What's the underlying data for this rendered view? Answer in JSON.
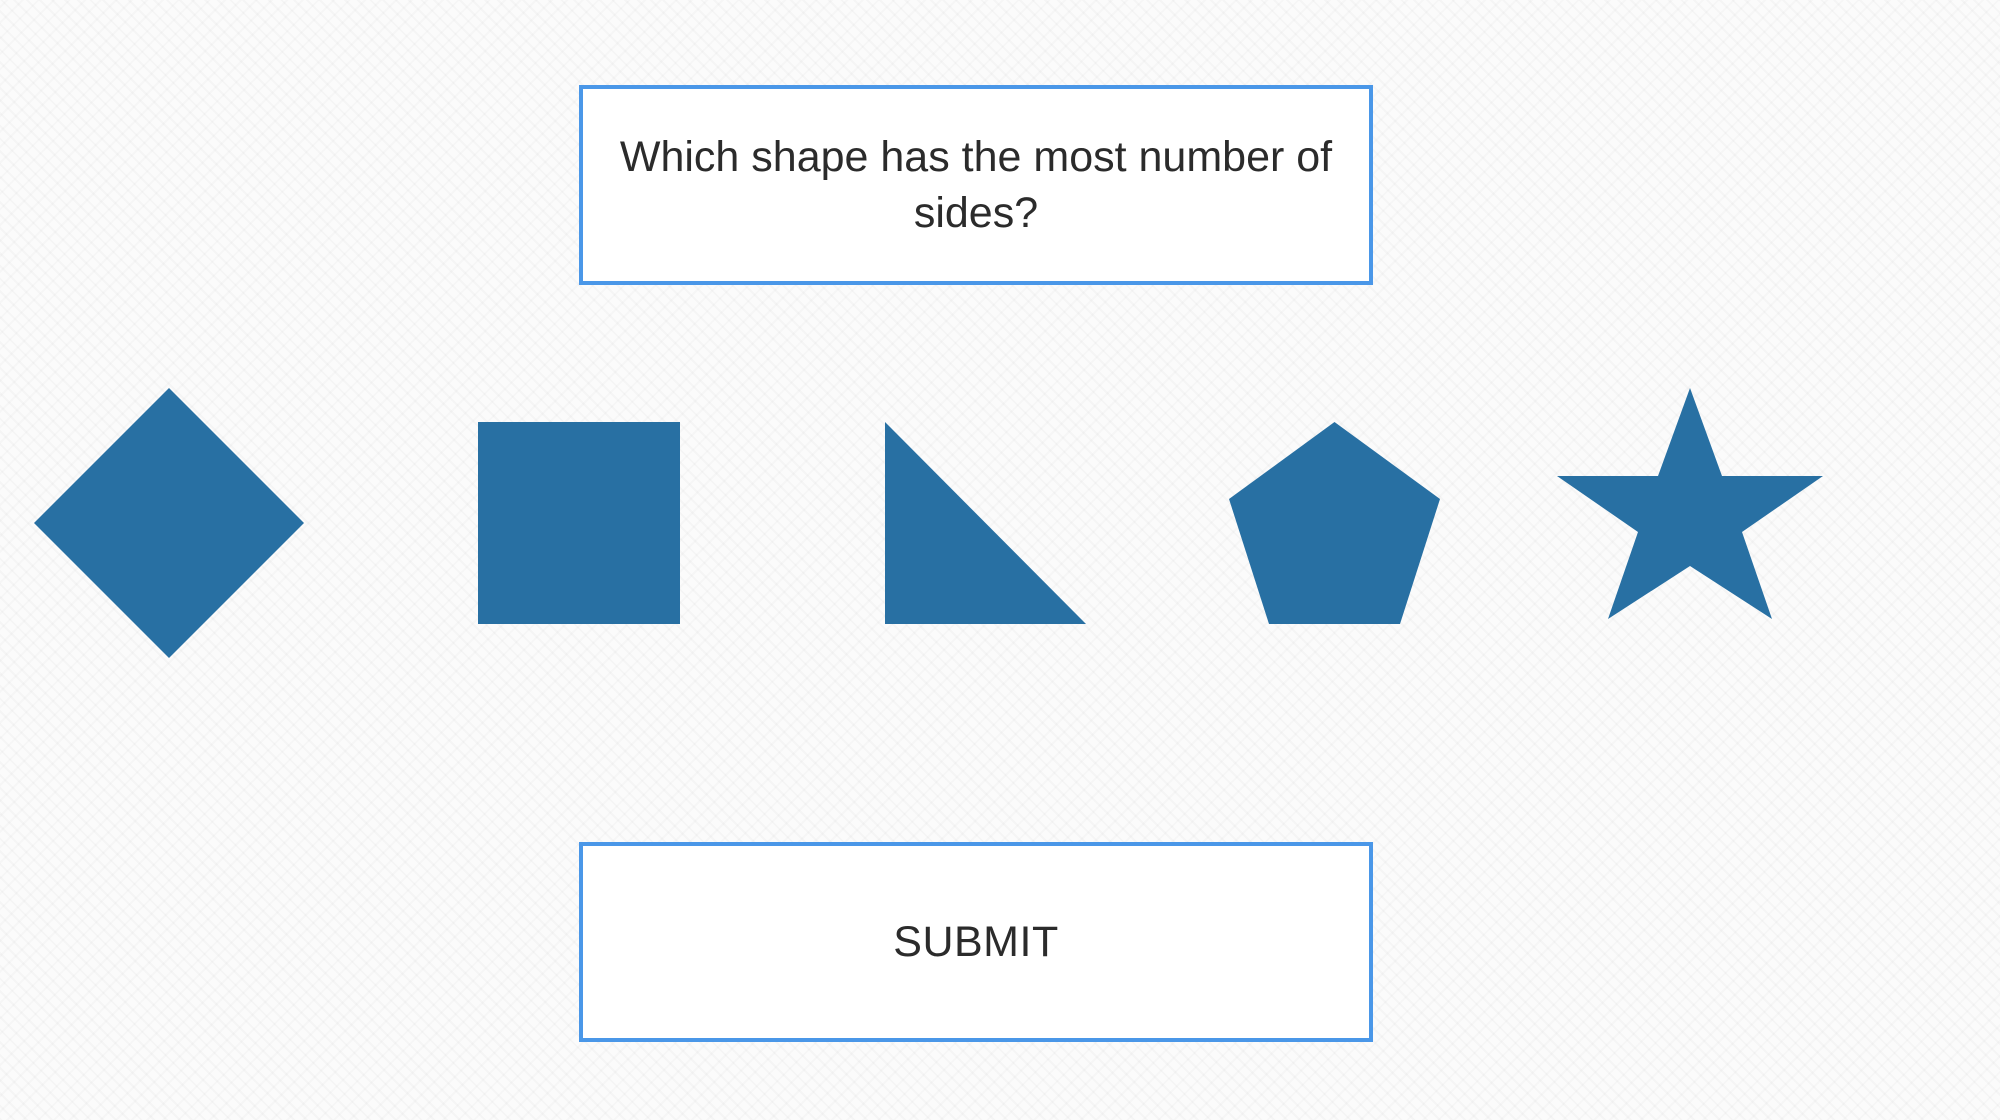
{
  "question": {
    "text": "Which shape has the most number of sides?"
  },
  "options": [
    {
      "shape": "diamond",
      "color": "#2870a3"
    },
    {
      "shape": "square",
      "color": "#2870a3"
    },
    {
      "shape": "right-triangle",
      "color": "#2870a3"
    },
    {
      "shape": "pentagon",
      "color": "#2870a3"
    },
    {
      "shape": "star",
      "color": "#2870a3"
    }
  ],
  "submit": {
    "label": "SUBMIT"
  },
  "colors": {
    "accent_border": "#4a97e8",
    "shape_fill": "#2870a3",
    "text": "#2b2b2b"
  }
}
